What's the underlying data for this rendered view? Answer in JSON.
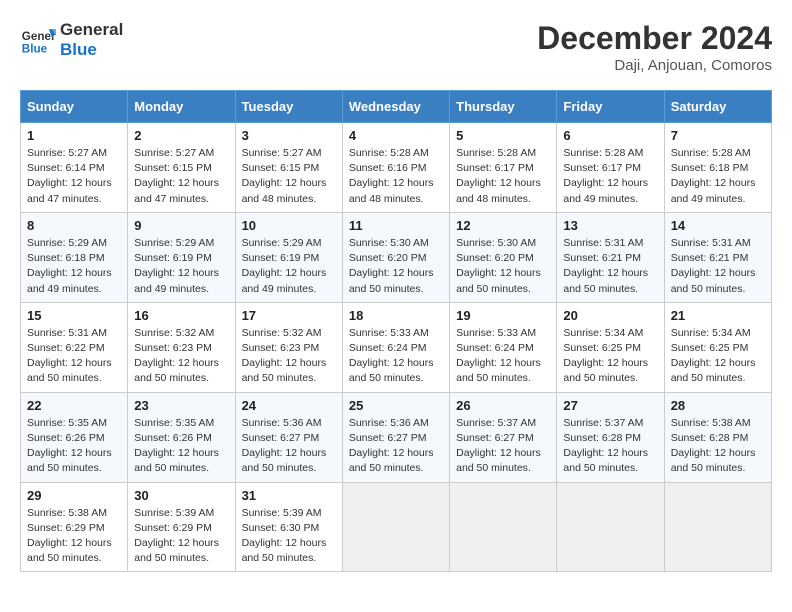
{
  "logo": {
    "line1": "General",
    "line2": "Blue"
  },
  "header": {
    "month": "December 2024",
    "location": "Daji, Anjouan, Comoros"
  },
  "weekdays": [
    "Sunday",
    "Monday",
    "Tuesday",
    "Wednesday",
    "Thursday",
    "Friday",
    "Saturday"
  ],
  "weeks": [
    [
      {
        "day": 1,
        "rise": "5:27 AM",
        "set": "6:14 PM",
        "daylight": "12 hours and 47 minutes."
      },
      {
        "day": 2,
        "rise": "5:27 AM",
        "set": "6:15 PM",
        "daylight": "12 hours and 47 minutes."
      },
      {
        "day": 3,
        "rise": "5:27 AM",
        "set": "6:15 PM",
        "daylight": "12 hours and 48 minutes."
      },
      {
        "day": 4,
        "rise": "5:28 AM",
        "set": "6:16 PM",
        "daylight": "12 hours and 48 minutes."
      },
      {
        "day": 5,
        "rise": "5:28 AM",
        "set": "6:17 PM",
        "daylight": "12 hours and 48 minutes."
      },
      {
        "day": 6,
        "rise": "5:28 AM",
        "set": "6:17 PM",
        "daylight": "12 hours and 49 minutes."
      },
      {
        "day": 7,
        "rise": "5:28 AM",
        "set": "6:18 PM",
        "daylight": "12 hours and 49 minutes."
      }
    ],
    [
      {
        "day": 8,
        "rise": "5:29 AM",
        "set": "6:18 PM",
        "daylight": "12 hours and 49 minutes."
      },
      {
        "day": 9,
        "rise": "5:29 AM",
        "set": "6:19 PM",
        "daylight": "12 hours and 49 minutes."
      },
      {
        "day": 10,
        "rise": "5:29 AM",
        "set": "6:19 PM",
        "daylight": "12 hours and 49 minutes."
      },
      {
        "day": 11,
        "rise": "5:30 AM",
        "set": "6:20 PM",
        "daylight": "12 hours and 50 minutes."
      },
      {
        "day": 12,
        "rise": "5:30 AM",
        "set": "6:20 PM",
        "daylight": "12 hours and 50 minutes."
      },
      {
        "day": 13,
        "rise": "5:31 AM",
        "set": "6:21 PM",
        "daylight": "12 hours and 50 minutes."
      },
      {
        "day": 14,
        "rise": "5:31 AM",
        "set": "6:21 PM",
        "daylight": "12 hours and 50 minutes."
      }
    ],
    [
      {
        "day": 15,
        "rise": "5:31 AM",
        "set": "6:22 PM",
        "daylight": "12 hours and 50 minutes."
      },
      {
        "day": 16,
        "rise": "5:32 AM",
        "set": "6:23 PM",
        "daylight": "12 hours and 50 minutes."
      },
      {
        "day": 17,
        "rise": "5:32 AM",
        "set": "6:23 PM",
        "daylight": "12 hours and 50 minutes."
      },
      {
        "day": 18,
        "rise": "5:33 AM",
        "set": "6:24 PM",
        "daylight": "12 hours and 50 minutes."
      },
      {
        "day": 19,
        "rise": "5:33 AM",
        "set": "6:24 PM",
        "daylight": "12 hours and 50 minutes."
      },
      {
        "day": 20,
        "rise": "5:34 AM",
        "set": "6:25 PM",
        "daylight": "12 hours and 50 minutes."
      },
      {
        "day": 21,
        "rise": "5:34 AM",
        "set": "6:25 PM",
        "daylight": "12 hours and 50 minutes."
      }
    ],
    [
      {
        "day": 22,
        "rise": "5:35 AM",
        "set": "6:26 PM",
        "daylight": "12 hours and 50 minutes."
      },
      {
        "day": 23,
        "rise": "5:35 AM",
        "set": "6:26 PM",
        "daylight": "12 hours and 50 minutes."
      },
      {
        "day": 24,
        "rise": "5:36 AM",
        "set": "6:27 PM",
        "daylight": "12 hours and 50 minutes."
      },
      {
        "day": 25,
        "rise": "5:36 AM",
        "set": "6:27 PM",
        "daylight": "12 hours and 50 minutes."
      },
      {
        "day": 26,
        "rise": "5:37 AM",
        "set": "6:27 PM",
        "daylight": "12 hours and 50 minutes."
      },
      {
        "day": 27,
        "rise": "5:37 AM",
        "set": "6:28 PM",
        "daylight": "12 hours and 50 minutes."
      },
      {
        "day": 28,
        "rise": "5:38 AM",
        "set": "6:28 PM",
        "daylight": "12 hours and 50 minutes."
      }
    ],
    [
      {
        "day": 29,
        "rise": "5:38 AM",
        "set": "6:29 PM",
        "daylight": "12 hours and 50 minutes."
      },
      {
        "day": 30,
        "rise": "5:39 AM",
        "set": "6:29 PM",
        "daylight": "12 hours and 50 minutes."
      },
      {
        "day": 31,
        "rise": "5:39 AM",
        "set": "6:30 PM",
        "daylight": "12 hours and 50 minutes."
      },
      null,
      null,
      null,
      null
    ]
  ],
  "labels": {
    "sunrise": "Sunrise:",
    "sunset": "Sunset:",
    "daylight": "Daylight:"
  }
}
